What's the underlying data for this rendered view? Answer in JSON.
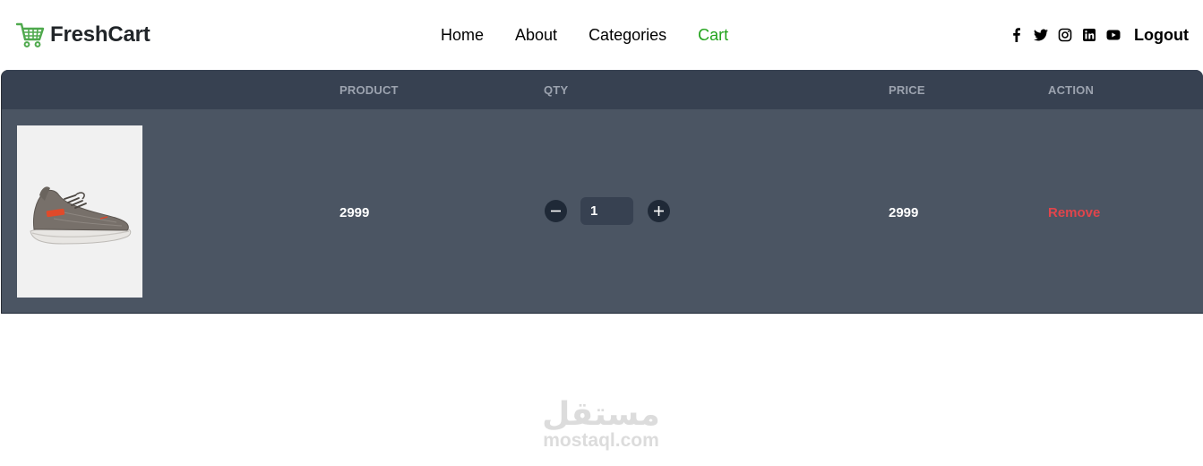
{
  "brand": {
    "name": "FreshCart",
    "icon": "cart-icon",
    "icon_color": "#4fa94d"
  },
  "nav": {
    "links": [
      {
        "label": "Home",
        "active": false
      },
      {
        "label": "About",
        "active": false
      },
      {
        "label": "Categories",
        "active": false
      },
      {
        "label": "Cart",
        "active": true
      }
    ],
    "active_color": "#22a31c",
    "social": [
      "facebook-icon",
      "twitter-icon",
      "instagram-icon",
      "linkedin-icon",
      "youtube-icon"
    ],
    "logout_label": "Logout"
  },
  "table": {
    "headers": {
      "product": "PRODUCT",
      "qty": "QTY",
      "price": "PRICE",
      "action": "ACTION"
    },
    "rows": [
      {
        "image": "shoe-image",
        "product": "2999",
        "quantity": "1",
        "price": "2999",
        "action": "Remove"
      }
    ],
    "header_bg": "#374151",
    "row_bg": "#4b5563",
    "remove_color": "#e0454c"
  },
  "watermark": {
    "arabic": "مستقل",
    "latin": "mostaql.com"
  }
}
